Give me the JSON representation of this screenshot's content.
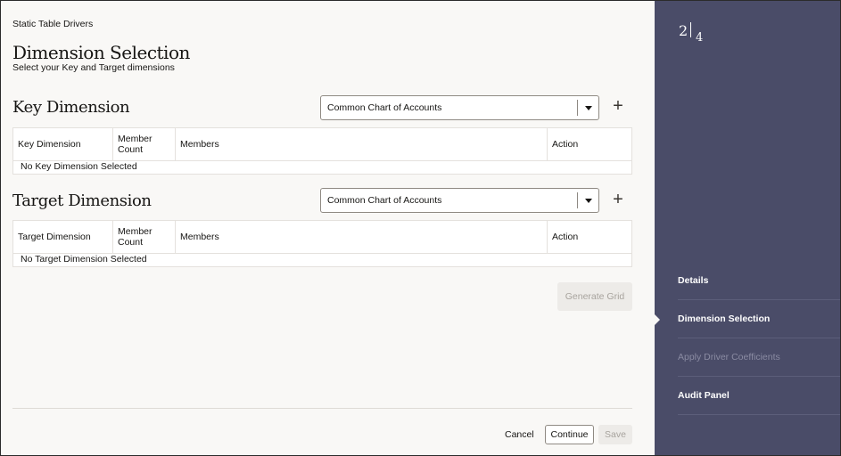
{
  "breadcrumb": "Static Table Drivers",
  "page": {
    "title": "Dimension Selection",
    "subtitle": "Select your Key and Target dimensions"
  },
  "key_section": {
    "title": "Key Dimension",
    "select_value": "Common Chart of Accounts",
    "columns": [
      "Key Dimension",
      "Member Count",
      "Members",
      "Action"
    ],
    "empty_text": "No Key Dimension Selected"
  },
  "target_section": {
    "title": "Target Dimension",
    "select_value": "Common Chart of Accounts",
    "columns": [
      "Target Dimension",
      "Member Count",
      "Members",
      "Action"
    ],
    "empty_text": "No Target Dimension Selected"
  },
  "buttons": {
    "generate_grid": "Generate Grid",
    "cancel": "Cancel",
    "continue": "Continue",
    "save": "Save"
  },
  "stepper": {
    "current": "2",
    "total": "4",
    "steps": [
      {
        "label": "Details",
        "state": "complete"
      },
      {
        "label": "Dimension Selection",
        "state": "active"
      },
      {
        "label": "Apply Driver Coefficients",
        "state": "disabled"
      },
      {
        "label": "Audit Panel",
        "state": "complete"
      }
    ]
  },
  "icons": {
    "add": "plus-icon",
    "dropdown": "chevron-down-icon",
    "current_step": "triangle-pointer-icon"
  },
  "colors": {
    "sidebar_bg": "#4a4c68",
    "main_bg": "#f9f8f6",
    "disabled_text": "#a7a39d"
  }
}
